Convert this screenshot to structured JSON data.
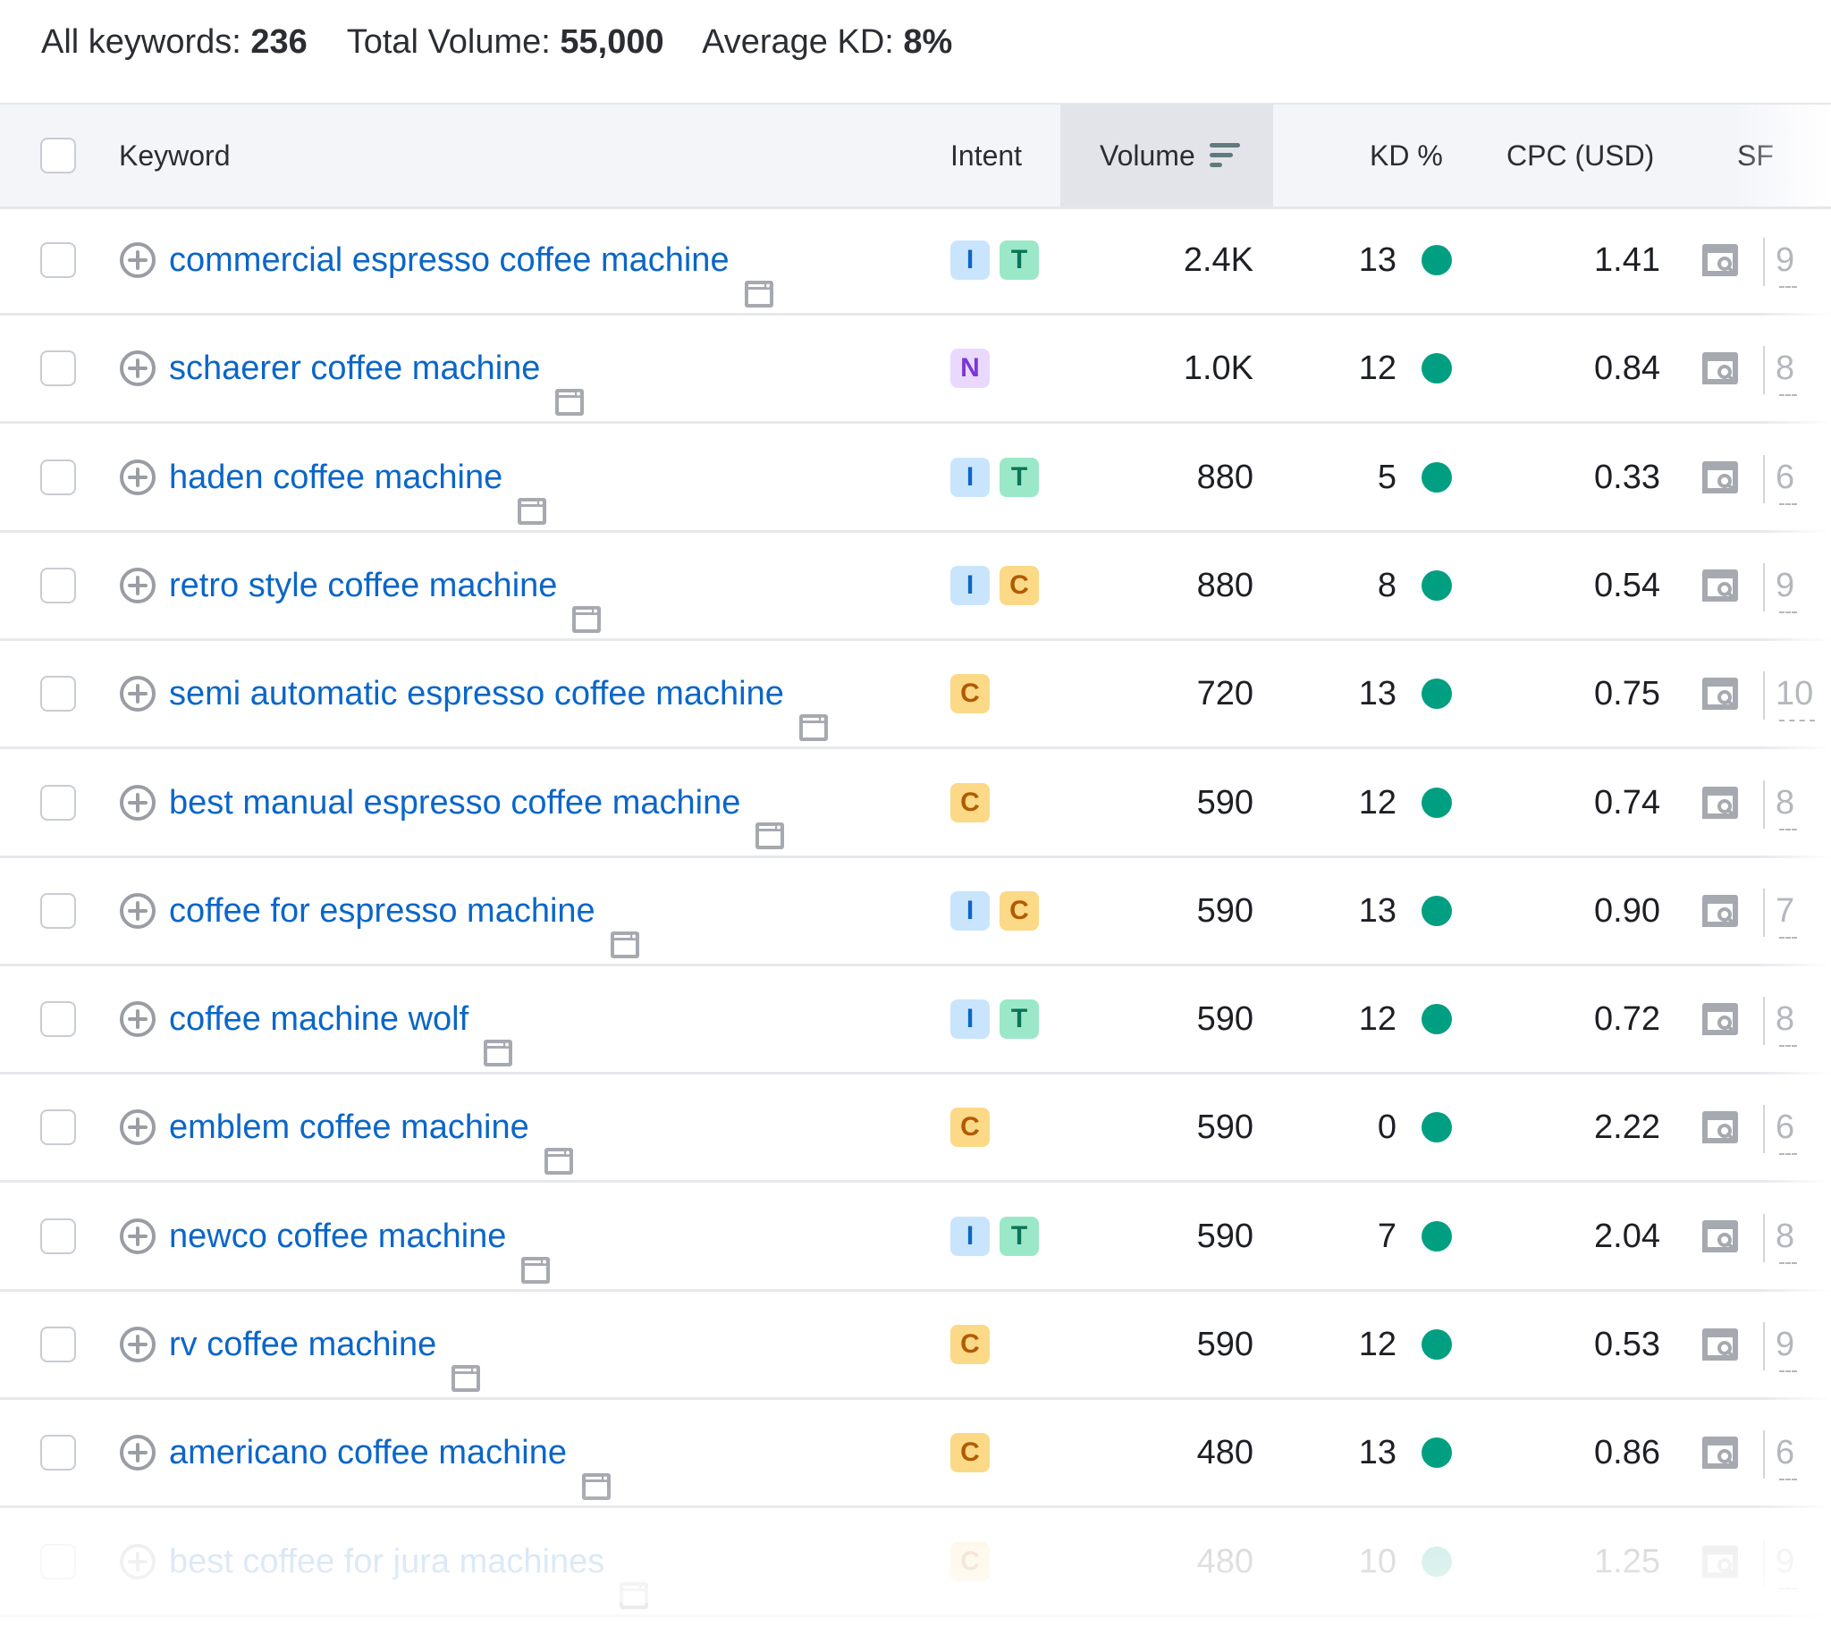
{
  "summary": {
    "all_keywords_label": "All keywords:",
    "all_keywords_value": "236",
    "total_volume_label": "Total Volume:",
    "total_volume_value": "55,000",
    "average_kd_label": "Average KD:",
    "average_kd_value": "8%"
  },
  "columns": {
    "keyword": "Keyword",
    "intent": "Intent",
    "volume": "Volume",
    "kd": "KD %",
    "cpc": "CPC (USD)",
    "sf": "SF"
  },
  "sorted_column": "volume",
  "colors": {
    "link": "#0b66c8",
    "kd_easy": "#009f81",
    "intent_I_bg": "#c9e5fd",
    "intent_T_bg": "#9be8c8",
    "intent_C_bg": "#fbd987",
    "intent_N_bg": "#ead9ff"
  },
  "icons": {
    "add": "plus-circle-icon",
    "serp": "serp-snapshot-icon",
    "sort": "sort-descending-icon",
    "sf": "serp-features-icon"
  },
  "rows": [
    {
      "keyword": "commercial espresso coffee machine",
      "intents": [
        "I",
        "T"
      ],
      "volume": "2.4K",
      "kd": "13",
      "cpc": "1.41",
      "sf": "9"
    },
    {
      "keyword": "schaerer coffee machine",
      "intents": [
        "N"
      ],
      "volume": "1.0K",
      "kd": "12",
      "cpc": "0.84",
      "sf": "8"
    },
    {
      "keyword": "haden coffee machine",
      "intents": [
        "I",
        "T"
      ],
      "volume": "880",
      "kd": "5",
      "cpc": "0.33",
      "sf": "6"
    },
    {
      "keyword": "retro style coffee machine",
      "intents": [
        "I",
        "C"
      ],
      "volume": "880",
      "kd": "8",
      "cpc": "0.54",
      "sf": "9"
    },
    {
      "keyword": "semi automatic espresso coffee machine",
      "intents": [
        "C"
      ],
      "volume": "720",
      "kd": "13",
      "cpc": "0.75",
      "sf": "10"
    },
    {
      "keyword": "best manual espresso coffee machine",
      "intents": [
        "C"
      ],
      "volume": "590",
      "kd": "12",
      "cpc": "0.74",
      "sf": "8"
    },
    {
      "keyword": "coffee for espresso machine",
      "intents": [
        "I",
        "C"
      ],
      "volume": "590",
      "kd": "13",
      "cpc": "0.90",
      "sf": "7"
    },
    {
      "keyword": "coffee machine wolf",
      "intents": [
        "I",
        "T"
      ],
      "volume": "590",
      "kd": "12",
      "cpc": "0.72",
      "sf": "8"
    },
    {
      "keyword": "emblem coffee machine",
      "intents": [
        "C"
      ],
      "volume": "590",
      "kd": "0",
      "cpc": "2.22",
      "sf": "6"
    },
    {
      "keyword": "newco coffee machine",
      "intents": [
        "I",
        "T"
      ],
      "volume": "590",
      "kd": "7",
      "cpc": "2.04",
      "sf": "8"
    },
    {
      "keyword": "rv coffee machine",
      "intents": [
        "C"
      ],
      "volume": "590",
      "kd": "12",
      "cpc": "0.53",
      "sf": "9"
    },
    {
      "keyword": "americano coffee machine",
      "intents": [
        "C"
      ],
      "volume": "480",
      "kd": "13",
      "cpc": "0.86",
      "sf": "6"
    },
    {
      "keyword": "best coffee for jura machines",
      "intents": [
        "C"
      ],
      "volume": "480",
      "kd": "10",
      "cpc": "1.25",
      "sf": "9",
      "faded": true
    }
  ]
}
